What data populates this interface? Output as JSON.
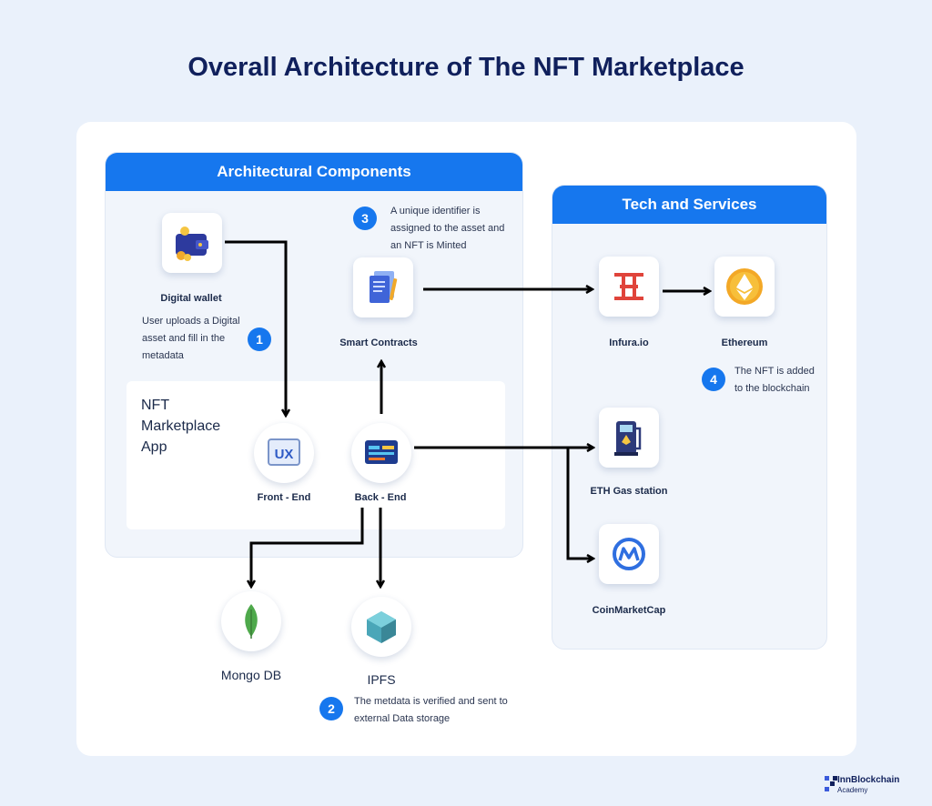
{
  "title": "Overall Architecture of The NFT Marketplace",
  "panels": {
    "architecture": "Architectural Components",
    "tech": "Tech and Services"
  },
  "app_label": "NFT\nMarketplace\nApp",
  "nodes": {
    "digital_wallet": "Digital wallet",
    "smart_contracts": "Smart Contracts",
    "front_end": "Front - End",
    "back_end": "Back - End",
    "mongo_db": "Mongo DB",
    "ipfs": "IPFS",
    "infura": "Infura.io",
    "ethereum": "Ethereum",
    "eth_gas": "ETH Gas station",
    "coinmarketcap": "CoinMarketCap"
  },
  "steps": [
    {
      "number": "1",
      "text": "User uploads a Digital asset and fill in the metadata"
    },
    {
      "number": "2",
      "text": "The metdata is verified and sent to external Data storage"
    },
    {
      "number": "3",
      "text": "A unique identifier is assigned to the asset and an NFT is Minted"
    },
    {
      "number": "4",
      "text": "The NFT is added to the blockchain"
    }
  ],
  "icons": {
    "ux_text": "UX"
  },
  "brand": {
    "line1": "InnBlockchain",
    "line2": "Academy"
  },
  "colors": {
    "accent": "#1677ee",
    "title": "#10205c",
    "background": "#eaf1fb"
  }
}
